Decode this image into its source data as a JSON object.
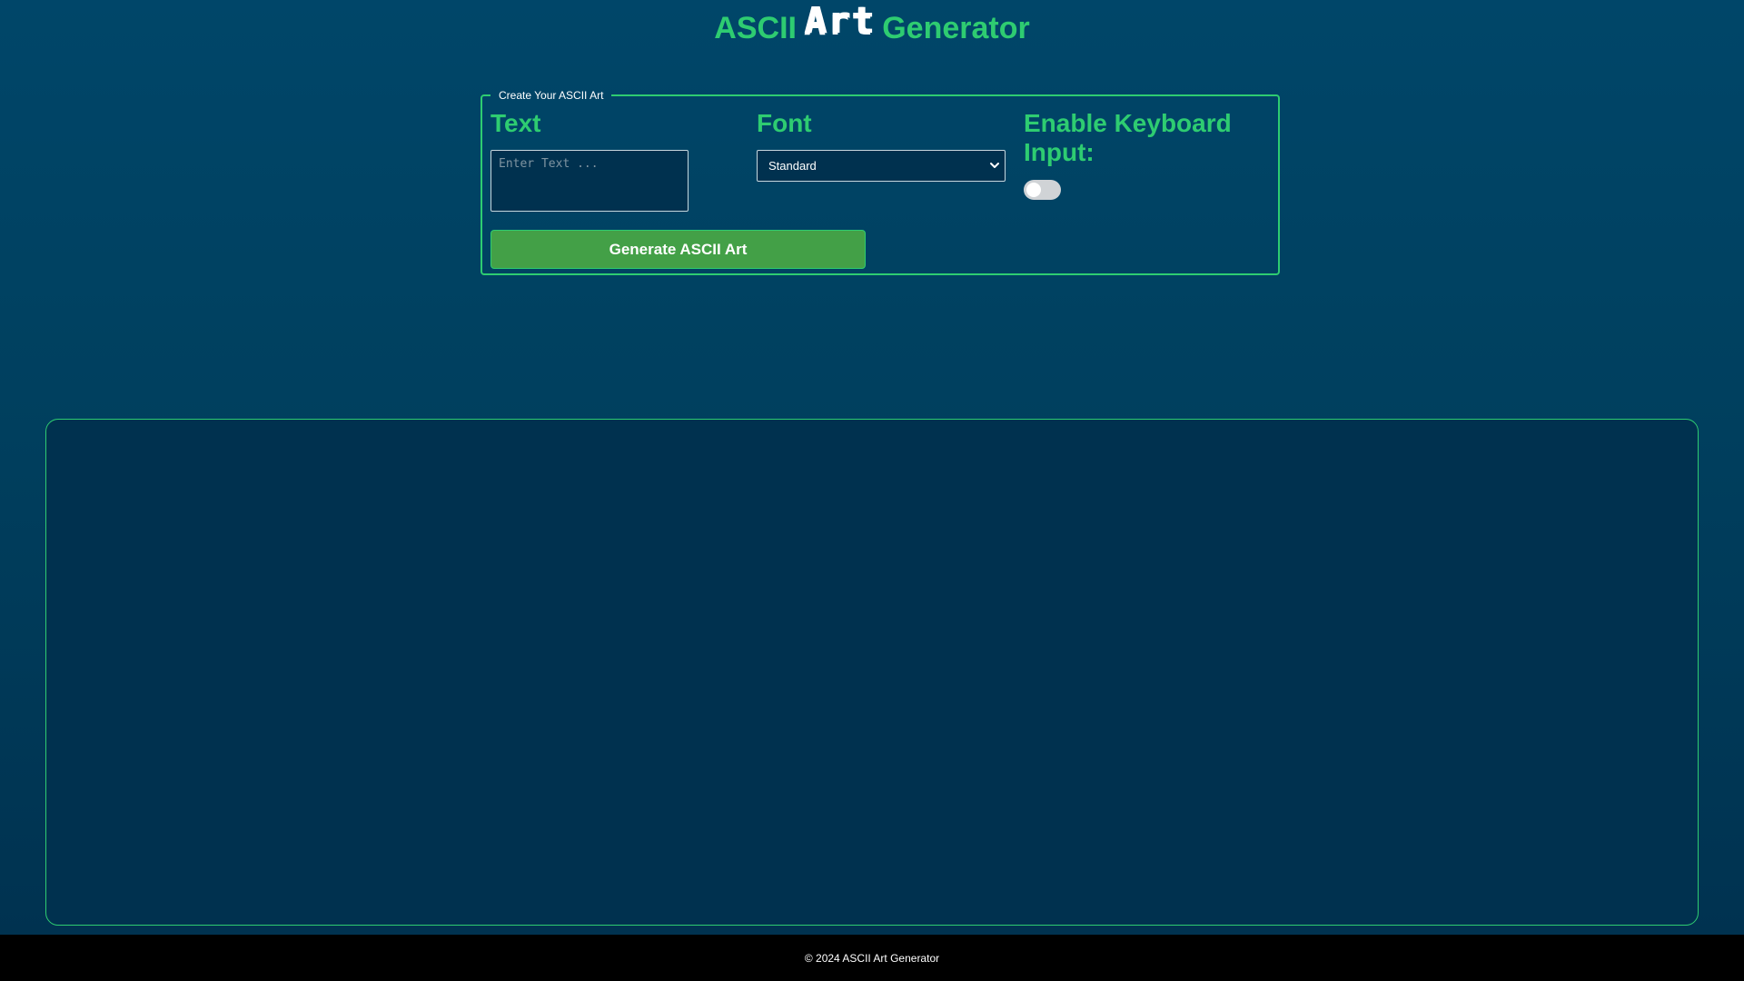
{
  "header": {
    "title_prefix": "ASCII",
    "title_art": "Art",
    "title_suffix": "Generator"
  },
  "form": {
    "legend": "Create Your ASCII Art",
    "text_label": "Text",
    "text_placeholder": "Enter Text ...",
    "text_value": "",
    "font_label": "Font",
    "font_selected": "Standard",
    "keyboard_label": "Enable Keyboard Input:",
    "keyboard_enabled": false,
    "generate_label": "Generate ASCII Art"
  },
  "output": {
    "content": ""
  },
  "footer": {
    "text": "© 2024 ASCII Art Generator"
  },
  "colors": {
    "accent": "#2ecc71",
    "background": "#004669",
    "button": "#43a047",
    "footer": "#000000"
  },
  "icons": {
    "select_chevron": "chevron-down-icon"
  }
}
